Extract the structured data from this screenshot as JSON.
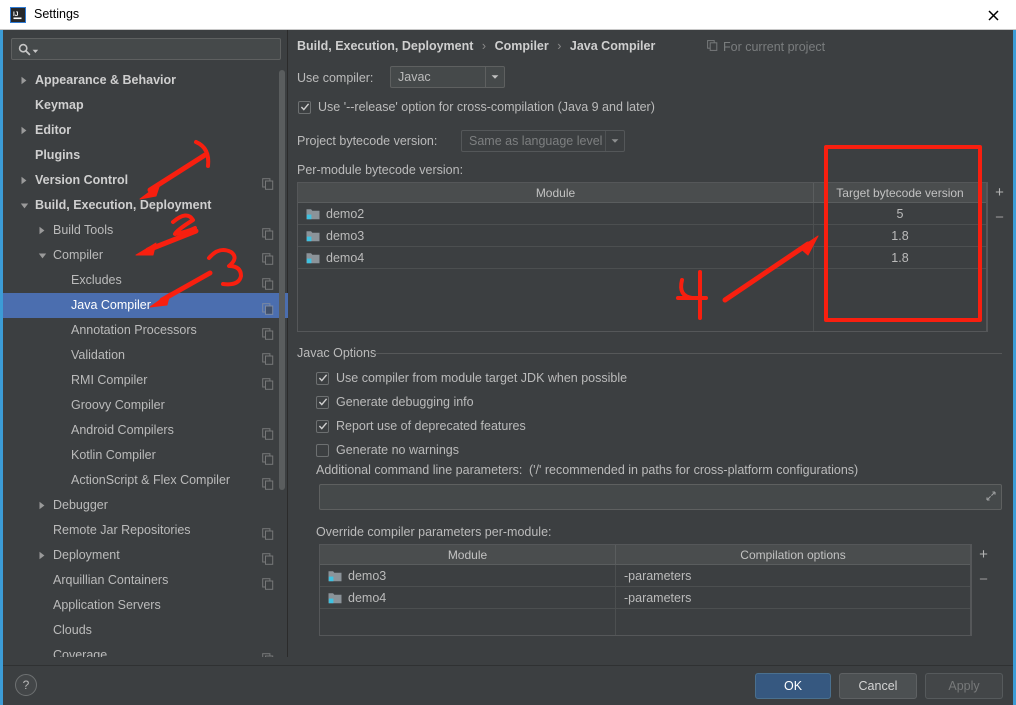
{
  "window": {
    "title": "Settings",
    "logo_icon": "intellij-idea-icon",
    "close_icon": "close-icon"
  },
  "sidebar": {
    "search": {
      "placeholder": "",
      "value": "",
      "icon": "search-icon"
    },
    "items": [
      {
        "label": "Appearance & Behavior",
        "indent": 0,
        "expander": "collapsed",
        "bold": true,
        "copy": false,
        "selected": false
      },
      {
        "label": "Keymap",
        "indent": 0,
        "expander": "none",
        "bold": true,
        "copy": false,
        "selected": false
      },
      {
        "label": "Editor",
        "indent": 0,
        "expander": "collapsed",
        "bold": true,
        "copy": false,
        "selected": false
      },
      {
        "label": "Plugins",
        "indent": 0,
        "expander": "none",
        "bold": true,
        "copy": false,
        "selected": false
      },
      {
        "label": "Version Control",
        "indent": 0,
        "expander": "collapsed",
        "bold": true,
        "copy": true,
        "selected": false
      },
      {
        "label": "Build, Execution, Deployment",
        "indent": 0,
        "expander": "expanded",
        "bold": true,
        "copy": false,
        "selected": false
      },
      {
        "label": "Build Tools",
        "indent": 1,
        "expander": "collapsed",
        "bold": false,
        "copy": true,
        "selected": false
      },
      {
        "label": "Compiler",
        "indent": 1,
        "expander": "expanded",
        "bold": false,
        "copy": true,
        "selected": false
      },
      {
        "label": "Excludes",
        "indent": 2,
        "expander": "none",
        "bold": false,
        "copy": true,
        "selected": false
      },
      {
        "label": "Java Compiler",
        "indent": 2,
        "expander": "none",
        "bold": false,
        "copy": true,
        "selected": true
      },
      {
        "label": "Annotation Processors",
        "indent": 2,
        "expander": "none",
        "bold": false,
        "copy": true,
        "selected": false
      },
      {
        "label": "Validation",
        "indent": 2,
        "expander": "none",
        "bold": false,
        "copy": true,
        "selected": false
      },
      {
        "label": "RMI Compiler",
        "indent": 2,
        "expander": "none",
        "bold": false,
        "copy": true,
        "selected": false
      },
      {
        "label": "Groovy Compiler",
        "indent": 2,
        "expander": "none",
        "bold": false,
        "copy": false,
        "selected": false
      },
      {
        "label": "Android Compilers",
        "indent": 2,
        "expander": "none",
        "bold": false,
        "copy": true,
        "selected": false
      },
      {
        "label": "Kotlin Compiler",
        "indent": 2,
        "expander": "none",
        "bold": false,
        "copy": true,
        "selected": false
      },
      {
        "label": "ActionScript & Flex Compiler",
        "indent": 2,
        "expander": "none",
        "bold": false,
        "copy": true,
        "selected": false
      },
      {
        "label": "Debugger",
        "indent": 1,
        "expander": "collapsed",
        "bold": false,
        "copy": false,
        "selected": false
      },
      {
        "label": "Remote Jar Repositories",
        "indent": 1,
        "expander": "none",
        "bold": false,
        "copy": true,
        "selected": false
      },
      {
        "label": "Deployment",
        "indent": 1,
        "expander": "collapsed",
        "bold": false,
        "copy": true,
        "selected": false
      },
      {
        "label": "Arquillian Containers",
        "indent": 1,
        "expander": "none",
        "bold": false,
        "copy": true,
        "selected": false
      },
      {
        "label": "Application Servers",
        "indent": 1,
        "expander": "none",
        "bold": false,
        "copy": false,
        "selected": false
      },
      {
        "label": "Clouds",
        "indent": 1,
        "expander": "none",
        "bold": false,
        "copy": false,
        "selected": false
      },
      {
        "label": "Coverage",
        "indent": 1,
        "expander": "none",
        "bold": false,
        "copy": true,
        "selected": false
      }
    ]
  },
  "main": {
    "breadcrumb": [
      "Build, Execution, Deployment",
      "Compiler",
      "Java Compiler"
    ],
    "breadcrumb_separator": "›",
    "for_current_project": "For current project",
    "for_current_project_icon": "copy-icon",
    "use_compiler_label": "Use compiler:",
    "use_compiler_value": "Javac",
    "release_option_label": "Use '--release' option for cross-compilation (Java 9 and later)",
    "release_option_checked": true,
    "project_bytecode_label": "Project bytecode version:",
    "project_bytecode_value": "Same as language level",
    "project_bytecode_disabled": true,
    "per_module_label": "Per-module bytecode version:",
    "per_module_table": {
      "columns": [
        "Module",
        "Target bytecode version"
      ],
      "rows": [
        {
          "module": "demo2",
          "value": "5"
        },
        {
          "module": "demo3",
          "value": "1.8"
        },
        {
          "module": "demo4",
          "value": "1.8"
        }
      ],
      "add_button": "+",
      "remove_button": "−"
    },
    "javac_options": {
      "title": "Javac Options",
      "checkboxes": [
        {
          "label": "Use compiler from module target JDK when possible",
          "checked": true
        },
        {
          "label": "Generate debugging info",
          "checked": true
        },
        {
          "label": "Report use of deprecated features",
          "checked": true
        },
        {
          "label": "Generate no warnings",
          "checked": false
        }
      ],
      "additional_params_label": "Additional command line parameters:",
      "additional_params_hint": "('/' recommended in paths for cross-platform configurations)",
      "additional_params_value": "",
      "expand_icon": "expand-icon"
    },
    "override_label": "Override compiler parameters per-module:",
    "override_table": {
      "columns": [
        "Module",
        "Compilation options"
      ],
      "rows": [
        {
          "module": "demo3",
          "options": "-parameters"
        },
        {
          "module": "demo4",
          "options": "-parameters"
        }
      ],
      "add_button": "+",
      "remove_button": "−"
    }
  },
  "footer": {
    "help_label": "?",
    "ok_label": "OK",
    "cancel_label": "Cancel",
    "apply_label": "Apply",
    "apply_disabled": true
  },
  "annotations": {
    "color": "#f81f0f",
    "marks": [
      "1",
      "2",
      "3",
      "4"
    ]
  },
  "colors": {
    "accent": "#4b6eaf",
    "primary_button": "#365880",
    "background": "#3c3f41",
    "titlebar": "#ffffff",
    "annotation_red": "#f81f0f",
    "window_border": "#3c9cd6"
  }
}
